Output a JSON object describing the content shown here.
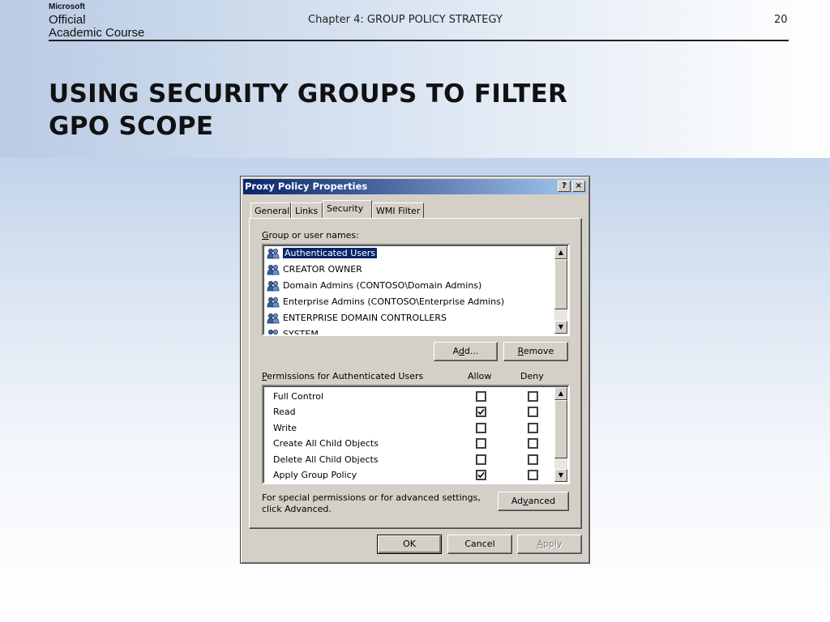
{
  "slide": {
    "logo": {
      "line1": "Microsoft",
      "line2": "Official",
      "line3": "Academic Course"
    },
    "chapter": "Chapter 4: GROUP POLICY STRATEGY",
    "page_number": "20",
    "title_line1": "USING SECURITY GROUPS TO FILTER",
    "title_line2": "GPO SCOPE"
  },
  "dialog": {
    "title": "Proxy Policy Properties",
    "help_button": "?",
    "close_button": "×",
    "tabs": [
      {
        "label": "General",
        "active": false
      },
      {
        "label": "Links",
        "active": false
      },
      {
        "label": "Security",
        "active": true
      },
      {
        "label": "WMI Filter",
        "active": false
      }
    ],
    "groups_label_prefix": "G",
    "groups_label_rest": "roup or user names:",
    "groups": [
      {
        "name": "Authenticated Users",
        "selected": true
      },
      {
        "name": "CREATOR OWNER",
        "selected": false
      },
      {
        "name": "Domain Admins (CONTOSO\\Domain Admins)",
        "selected": false
      },
      {
        "name": "Enterprise Admins (CONTOSO\\Enterprise Admins)",
        "selected": false
      },
      {
        "name": "ENTERPRISE DOMAIN CONTROLLERS",
        "selected": false
      },
      {
        "name": "SYSTEM",
        "selected": false
      }
    ],
    "add_button_pre": "A",
    "add_button_ul": "d",
    "add_button_post": "d...",
    "remove_button_ul": "R",
    "remove_button_post": "emove",
    "permissions_label_ul": "P",
    "permissions_label_rest": "ermissions for Authenticated Users",
    "allow_header": "Allow",
    "deny_header": "Deny",
    "permissions": [
      {
        "name": "Full Control",
        "allow": false,
        "deny": false
      },
      {
        "name": "Read",
        "allow": true,
        "deny": false
      },
      {
        "name": "Write",
        "allow": false,
        "deny": false
      },
      {
        "name": "Create All Child Objects",
        "allow": false,
        "deny": false
      },
      {
        "name": "Delete All Child Objects",
        "allow": false,
        "deny": false
      },
      {
        "name": "Apply Group Policy",
        "allow": true,
        "deny": false
      }
    ],
    "special_note_line1": "For special permissions or for advanced settings,",
    "special_note_line2": "click Advanced.",
    "advanced_button_pre": "Ad",
    "advanced_button_ul": "v",
    "advanced_button_post": "anced",
    "ok_button": "OK",
    "cancel_button": "Cancel",
    "apply_button_ul": "A",
    "apply_button_post": "pply"
  }
}
